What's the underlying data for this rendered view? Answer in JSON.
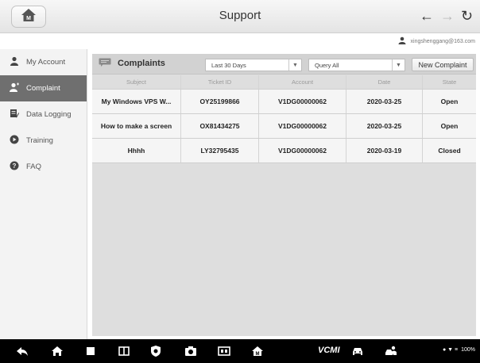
{
  "window": {
    "title": "Support"
  },
  "nav": {
    "back_icon": "arrow-left-icon",
    "forward_icon": "arrow-right-icon",
    "refresh_icon": "refresh-icon",
    "home_icon": "home-icon"
  },
  "user": {
    "email": "xingshenggang@163.com",
    "icon": "person-icon"
  },
  "sidebar": {
    "items": [
      {
        "label": "My Account",
        "icon": "person-icon",
        "active": false
      },
      {
        "label": "Complaint",
        "icon": "person-mic-icon",
        "active": true
      },
      {
        "label": "Data Logging",
        "icon": "edit-document-icon",
        "active": false
      },
      {
        "label": "Training",
        "icon": "play-circle-icon",
        "active": false
      },
      {
        "label": "FAQ",
        "icon": "help-circle-icon",
        "active": false
      }
    ]
  },
  "toolbar": {
    "title": "Complaints",
    "period_value": "Last 30 Days",
    "query_value": "Query All",
    "new_button": "New Complaint"
  },
  "table": {
    "columns": [
      "Subject",
      "Ticket ID",
      "Account",
      "Date",
      "State"
    ],
    "rows": [
      {
        "subject": "My Windows VPS W...",
        "ticket_id": "OY25199866",
        "account": "V1DG00000062",
        "date": "2020-03-25",
        "state": "Open"
      },
      {
        "subject": "How to make a screen",
        "ticket_id": "OX81434275",
        "account": "V1DG00000062",
        "date": "2020-03-25",
        "state": "Open"
      },
      {
        "subject": "Hhhh",
        "ticket_id": "LY32795435",
        "account": "V1DG00000062",
        "date": "2020-03-19",
        "state": "Closed"
      }
    ]
  },
  "bottom_bar": {
    "vcm_label": "VCMI",
    "status_text": "100%",
    "icons": [
      "back-icon",
      "home-icon",
      "stop-icon",
      "recent-apps-icon",
      "shield-icon",
      "camera-icon",
      "screen-mirror-icon",
      "autel-home-icon",
      "vcm-icon",
      "car-icon",
      "car-person-icon"
    ]
  },
  "colors": {
    "active_sidebar": "#6f6f6f",
    "main_bg": "#dedede",
    "row_bg": "#f5f5f5",
    "bottom_bar": "#000000"
  }
}
